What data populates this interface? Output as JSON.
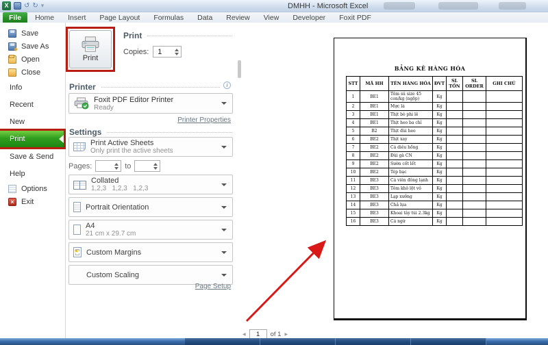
{
  "meta": {
    "colors": {
      "file_tab_green": "#2a9128",
      "print_highlight_green": "#2f9e1f",
      "annotation_red": "#b81d12",
      "arrow_red": "#d91818",
      "taskbar_blue": "#3b6eae"
    }
  },
  "window": {
    "title": "DMHH - Microsoft Excel"
  },
  "ribbon": {
    "tabs": [
      {
        "label": "File",
        "active": true,
        "name": "tab-file"
      },
      {
        "label": "Home",
        "name": "tab-home"
      },
      {
        "label": "Insert",
        "name": "tab-insert"
      },
      {
        "label": "Page Layout",
        "name": "tab-page-layout"
      },
      {
        "label": "Formulas",
        "name": "tab-formulas"
      },
      {
        "label": "Data",
        "name": "tab-data"
      },
      {
        "label": "Review",
        "name": "tab-review"
      },
      {
        "label": "View",
        "name": "tab-view"
      },
      {
        "label": "Developer",
        "name": "tab-developer"
      },
      {
        "label": "Foxit PDF",
        "name": "tab-foxit-pdf"
      }
    ]
  },
  "sidebar": {
    "items": [
      {
        "label": "Save",
        "small": true,
        "icon": "save-icon",
        "name": "sidebar-item-save"
      },
      {
        "label": "Save As",
        "small": true,
        "icon": "save-as-icon",
        "name": "sidebar-item-save-as"
      },
      {
        "label": "Open",
        "small": true,
        "icon": "open-folder-icon",
        "name": "sidebar-item-open"
      },
      {
        "label": "Close",
        "small": true,
        "icon": "close-folder-icon",
        "name": "sidebar-item-close"
      },
      {
        "label": "Info",
        "section": true,
        "name": "sidebar-item-info"
      },
      {
        "label": "Recent",
        "section": true,
        "name": "sidebar-item-recent"
      },
      {
        "label": "New",
        "section": true,
        "name": "sidebar-item-new"
      },
      {
        "label": "Print",
        "section": true,
        "active": true,
        "annotated": true,
        "name": "sidebar-item-print"
      },
      {
        "label": "Save & Send",
        "section": true,
        "name": "sidebar-item-save-and-send"
      },
      {
        "label": "Help",
        "section": true,
        "name": "sidebar-item-help"
      },
      {
        "label": "Options",
        "small": true,
        "icon": "options-icon",
        "name": "sidebar-item-options"
      },
      {
        "label": "Exit",
        "small": true,
        "icon": "exit-icon",
        "name": "sidebar-item-exit"
      }
    ]
  },
  "print_panel": {
    "print_button_label": "Print",
    "print_heading": "Print",
    "copies_label": "Copies:",
    "copies_value": "1",
    "printer_heading": "Printer",
    "printer_info_glyph": "i",
    "printer_name": "Foxit PDF Editor Printer",
    "printer_status": "Ready",
    "printer_properties_link": "Printer Properties",
    "settings_heading": "Settings",
    "sheet_dropdown": {
      "title": "Print Active Sheets",
      "subtitle": "Only print the active sheets"
    },
    "pages_label": "Pages:",
    "to_label": "to",
    "option_dropdowns": [
      {
        "title": "Collated",
        "subtitle": "1,2,3   1,2,3   1,2,3",
        "icon": "collated-icon",
        "name": "collation-dropdown"
      },
      {
        "title": "Portrait Orientation",
        "subtitle": "",
        "icon": "portrait-icon",
        "name": "orientation-dropdown"
      },
      {
        "title": "A4",
        "subtitle": "21 cm x 29.7 cm",
        "icon": "paper-size-icon",
        "name": "paper-size-dropdown"
      },
      {
        "title": "Custom Margins",
        "subtitle": "",
        "icon": "margins-icon",
        "name": "margins-dropdown"
      },
      {
        "title": "Custom Scaling",
        "subtitle": "",
        "icon": "scaling-icon",
        "name": "scaling-dropdown"
      }
    ],
    "page_setup_link": "Page Setup"
  },
  "preview": {
    "table_title": "BẢNG KÊ HÀNG HÓA",
    "columns": [
      "STT",
      "MÃ HH",
      "TÊN HÀNG HÓA",
      "ĐVT",
      "SL TỒN",
      "SL ORDER",
      "GHI CHÚ"
    ],
    "rows": [
      {
        "stt": "1",
        "ma": "BE1",
        "ten": "Tôm sú size 45 con/kg (ngộp)",
        "dvt": "Kg",
        "ton": "",
        "order": "",
        "ghichu": ""
      },
      {
        "stt": "2",
        "ma": "BE1",
        "ten": "Mực lá",
        "dvt": "Kg",
        "ton": "",
        "order": "",
        "ghichu": ""
      },
      {
        "stt": "3",
        "ma": "BE1",
        "ten": "Thịt bò phi lê",
        "dvt": "Kg",
        "ton": "",
        "order": "",
        "ghichu": ""
      },
      {
        "stt": "4",
        "ma": "BE1",
        "ten": "Thịt heo ba chỉ",
        "dvt": "Kg",
        "ton": "",
        "order": "",
        "ghichu": ""
      },
      {
        "stt": "5",
        "ma": "B2",
        "ten": "Thịt đùi heo",
        "dvt": "Kg",
        "ton": "",
        "order": "",
        "ghichu": ""
      },
      {
        "stt": "6",
        "ma": "BE2",
        "ten": "Thịt xay",
        "dvt": "Kg",
        "ton": "",
        "order": "",
        "ghichu": ""
      },
      {
        "stt": "7",
        "ma": "BE2",
        "ten": "Cá diêu hồng",
        "dvt": "Kg",
        "ton": "",
        "order": "",
        "ghichu": ""
      },
      {
        "stt": "8",
        "ma": "BE2",
        "ten": "Đùi gà CN",
        "dvt": "Kg",
        "ton": "",
        "order": "",
        "ghichu": ""
      },
      {
        "stt": "9",
        "ma": "BE2",
        "ten": "Sườn cốt lết",
        "dvt": "Kg",
        "ton": "",
        "order": "",
        "ghichu": ""
      },
      {
        "stt": "10",
        "ma": "BE2",
        "ten": "Tép bạc",
        "dvt": "Kg",
        "ton": "",
        "order": "",
        "ghichu": ""
      },
      {
        "stt": "11",
        "ma": "BE3",
        "ten": "Cá viên đông lạnh",
        "dvt": "Kg",
        "ton": "",
        "order": "",
        "ghichu": ""
      },
      {
        "stt": "12",
        "ma": "BE3",
        "ten": "Tôm khô lột vỏ",
        "dvt": "Kg",
        "ton": "",
        "order": "",
        "ghichu": ""
      },
      {
        "stt": "13",
        "ma": "BE3",
        "ten": "Lạp xưởng",
        "dvt": "Kg",
        "ton": "",
        "order": "",
        "ghichu": ""
      },
      {
        "stt": "14",
        "ma": "BE3",
        "ten": "Chả lụa",
        "dvt": "Kg",
        "ton": "",
        "order": "",
        "ghichu": ""
      },
      {
        "stt": "15",
        "ma": "BE3",
        "ten": "Khoai tây túi 2.3kg",
        "dvt": "Kg",
        "ton": "",
        "order": "",
        "ghichu": ""
      },
      {
        "stt": "16",
        "ma": "BE3",
        "ten": "Cá ngừ",
        "dvt": "Kg",
        "ton": "",
        "order": "",
        "ghichu": ""
      }
    ],
    "nav": {
      "prev": "◀",
      "page": "1",
      "of_label": "of 1",
      "next": "▶"
    }
  }
}
